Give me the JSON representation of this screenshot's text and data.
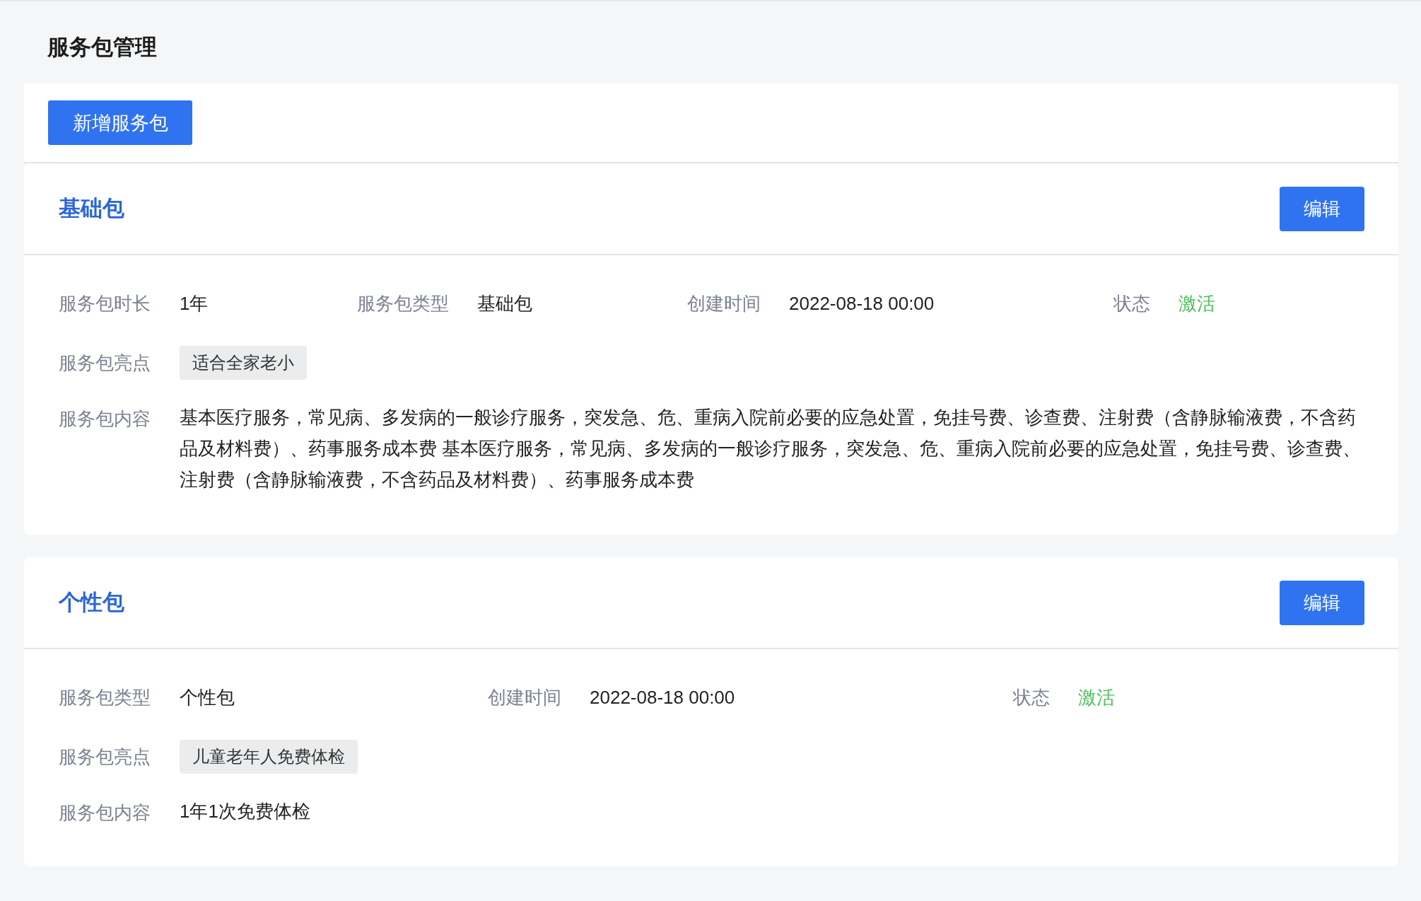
{
  "page_title": "服务包管理",
  "add_button": "新增服务包",
  "packages": [
    {
      "name": "基础包",
      "edit_button": "编辑",
      "fields": [
        {
          "kind": "text",
          "label": "服务包时长",
          "value": "1年"
        },
        {
          "kind": "text",
          "label": "服务包类型",
          "value": "基础包"
        },
        {
          "kind": "text",
          "label": "创建时间",
          "value": "2022-08-18 00:00"
        },
        {
          "kind": "status",
          "label": "状态",
          "value": "激活"
        }
      ],
      "highlights": {
        "label": "服务包亮点",
        "tags": [
          "适合全家老小"
        ]
      },
      "content": {
        "label": "服务包内容",
        "value": "基本医疗服务，常见病、多发病的一般诊疗服务，突发急、危、重病入院前必要的应急处置，免挂号费、诊查费、注射费（含静脉输液费，不含药品及材料费）、药事服务成本费 基本医疗服务，常见病、多发病的一般诊疗服务，突发急、危、重病入院前必要的应急处置，免挂号费、诊查费、注射费（含静脉输液费，不含药品及材料费）、药事服务成本费"
      }
    },
    {
      "name": "个性包",
      "edit_button": "编辑",
      "fields": [
        {
          "kind": "text",
          "label": "服务包类型",
          "value": "个性包"
        },
        {
          "kind": "text",
          "label": "创建时间",
          "value": "2022-08-18 00:00"
        },
        {
          "kind": "status",
          "label": "状态",
          "value": "激活"
        }
      ],
      "highlights": {
        "label": "服务包亮点",
        "tags": [
          "儿童老年人免费体检"
        ]
      },
      "content": {
        "label": "服务包内容",
        "value": "1年1次免费体检"
      }
    }
  ]
}
